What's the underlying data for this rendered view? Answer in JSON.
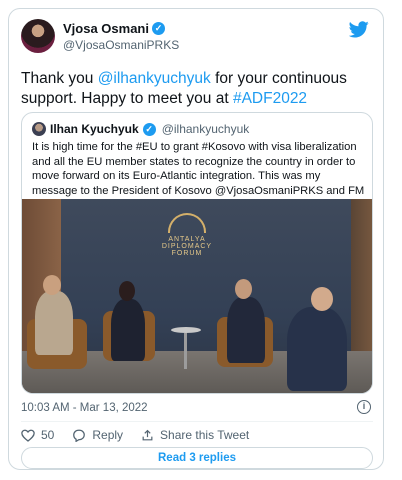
{
  "author": {
    "name": "Vjosa Osmani",
    "handle": "@VjosaOsmaniPRKS"
  },
  "tweet": {
    "text_1": "Thank you ",
    "mention": "@ilhankyuchyuk",
    "text_2": " for your continuous support. Happy to meet you at ",
    "hashtag": "#ADF2022"
  },
  "quoted": {
    "name": "Ilhan Kyuchyuk",
    "handle": "@ilhankyuchyuk",
    "text": "It is high time for the #EU to grant #Kosovo with visa liberalization and all the EU member states to recognize the country in order to  move forward on its Euro-Atlantic integration. This was my message to the President of Kosovo @VjosaOsmaniPRKS and FM @gervallaschwarz",
    "photo_logo": {
      "line1": "ANTALYA",
      "line2": "DIPLOMACY",
      "line3": "FORUM"
    }
  },
  "timestamp": "10:03 AM - Mar 13, 2022",
  "actions": {
    "like_count": "50",
    "reply_label": "Reply",
    "share_label": "Share this Tweet"
  },
  "replies_button": "Read 3 replies",
  "colors": {
    "accent": "#1d9bf0",
    "text": "#0f1419",
    "muted": "#536471",
    "border": "#cfd9de"
  }
}
